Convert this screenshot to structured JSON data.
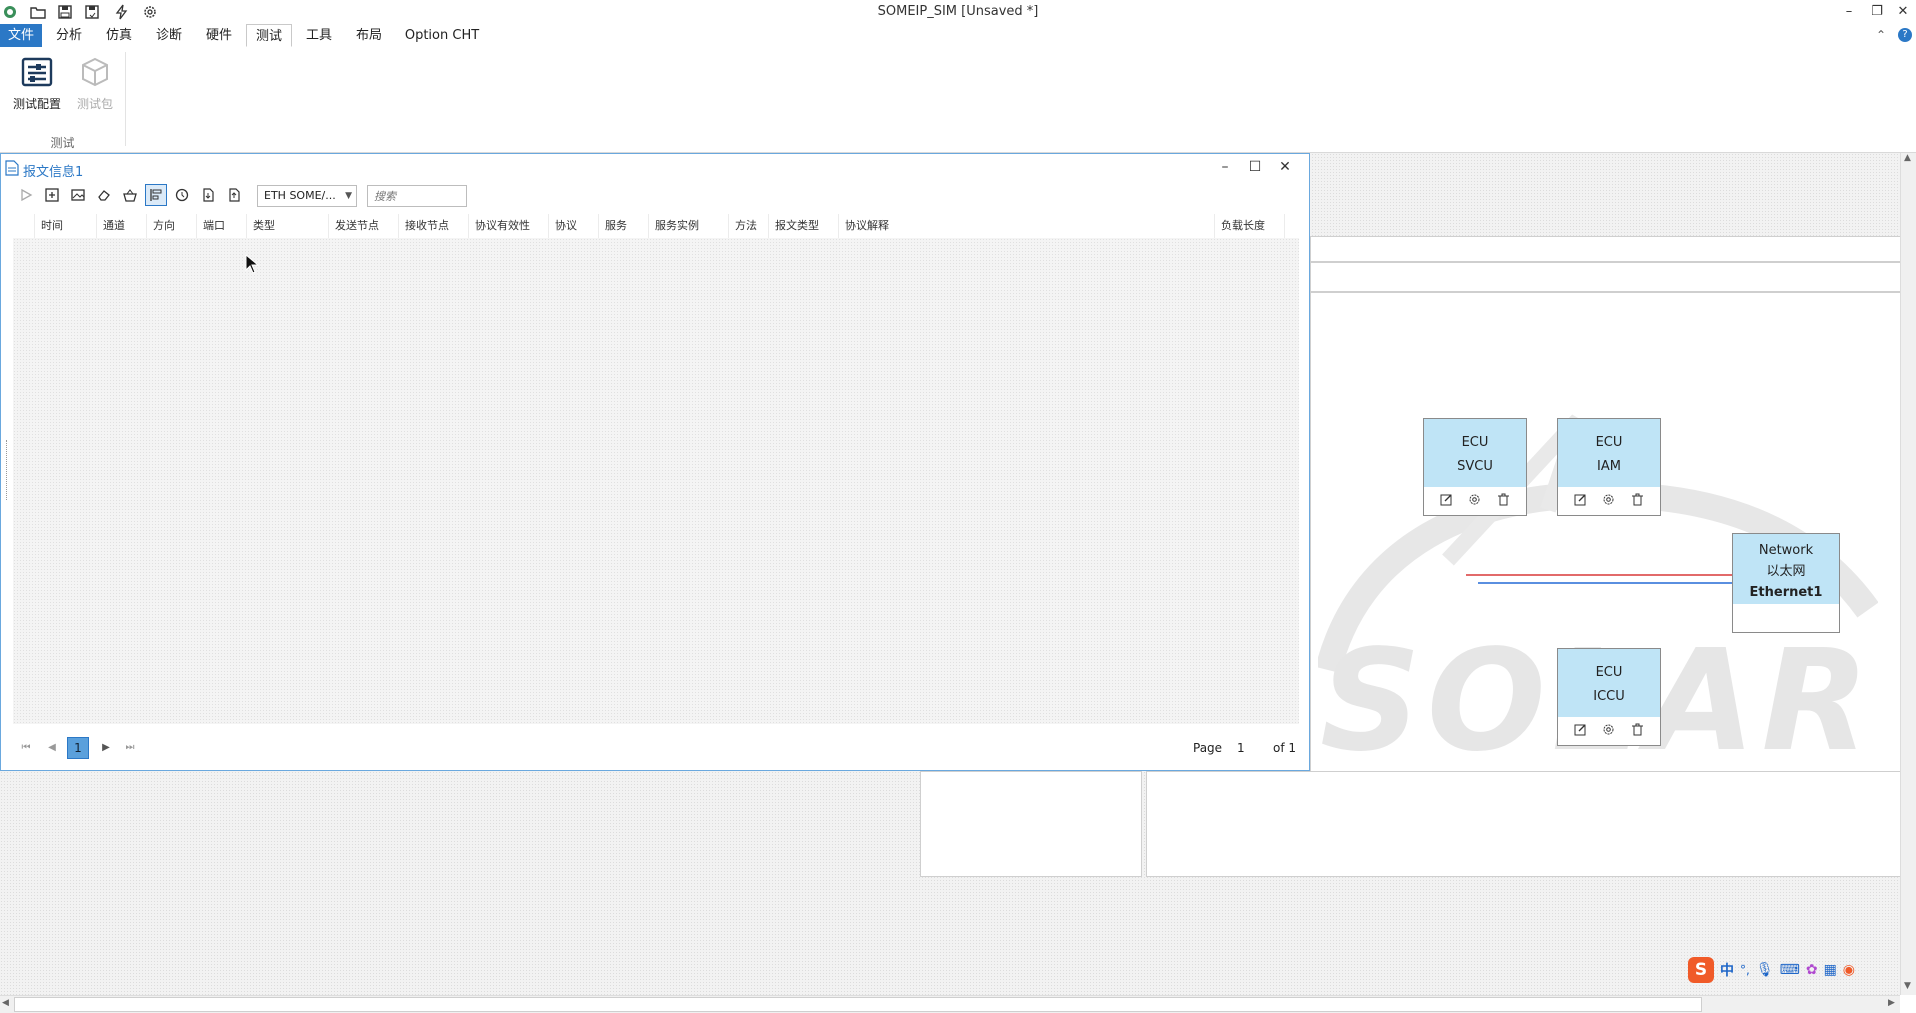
{
  "window": {
    "title": "SOMEIP_SIM [Unsaved *]",
    "controls": {
      "minimize": "–",
      "restore": "❐",
      "close": "✕"
    }
  },
  "menu": {
    "items": [
      {
        "label": "文件"
      },
      {
        "label": "分析"
      },
      {
        "label": "仿真"
      },
      {
        "label": "诊断"
      },
      {
        "label": "硬件"
      },
      {
        "label": "测试"
      },
      {
        "label": "工具"
      },
      {
        "label": "布局"
      },
      {
        "label": "Option CHT"
      }
    ],
    "active": "测试"
  },
  "ribbon": {
    "buttons": [
      {
        "label": "测试配置",
        "enabled": true
      },
      {
        "label": "测试包",
        "enabled": false
      }
    ],
    "group_label": "测试"
  },
  "message_window": {
    "title": "报文信息1",
    "controls": {
      "minimize": "–",
      "maximize": "☐",
      "close": "✕"
    },
    "protocol_combo": {
      "value": "ETH SOME/..."
    },
    "search": {
      "placeholder": "搜索"
    },
    "columns": [
      {
        "label": "时间"
      },
      {
        "label": "通道"
      },
      {
        "label": "方向"
      },
      {
        "label": "端口"
      },
      {
        "label": "类型"
      },
      {
        "label": "发送节点"
      },
      {
        "label": "接收节点"
      },
      {
        "label": "协议有效性"
      },
      {
        "label": "协议"
      },
      {
        "label": "服务"
      },
      {
        "label": "服务实例"
      },
      {
        "label": "方法"
      },
      {
        "label": "报文类型"
      },
      {
        "label": "协议解释"
      },
      {
        "label": "负载长度"
      }
    ],
    "pager": {
      "current": "1",
      "page_label": "Page",
      "page_value": "1",
      "of_label": "of 1"
    }
  },
  "topology": {
    "ecus": [
      {
        "kind": "ECU",
        "name": "SVCU"
      },
      {
        "kind": "ECU",
        "name": "IAM"
      },
      {
        "kind": "ECU",
        "name": "ICCU"
      }
    ],
    "network": {
      "kind": "Network",
      "type": "以太网",
      "name": "Ethernet1"
    },
    "watermark": "SOLAR",
    "colors": {
      "node_fill": "#bfe4f6",
      "link_red": "#e26a6a",
      "link_blue": "#5a8fe0"
    }
  },
  "ime": {
    "mode": "中",
    "punct": "°,"
  }
}
